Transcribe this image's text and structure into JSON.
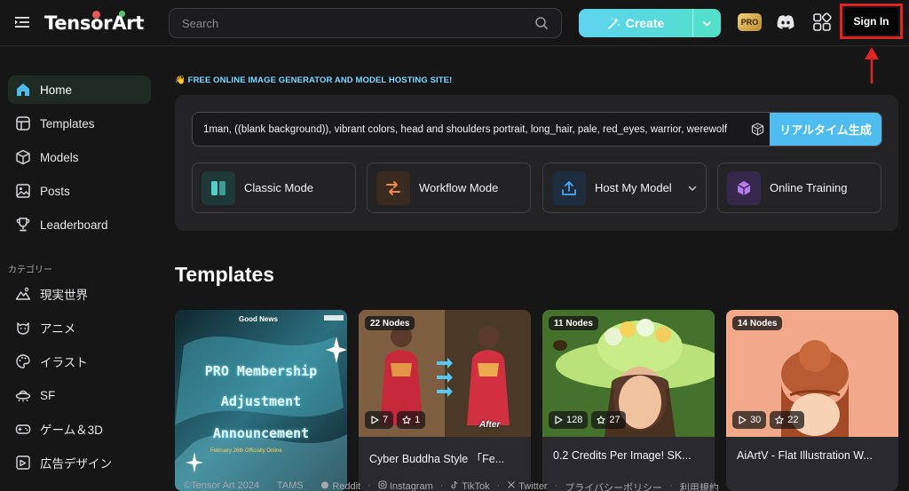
{
  "header": {
    "logo_text": "TensorArt",
    "search_placeholder": "Search",
    "create_label": "Create",
    "pro_label": "PRO",
    "signin_label": "Sign In"
  },
  "sidebar": {
    "items": [
      {
        "label": "Home",
        "icon": "home-icon"
      },
      {
        "label": "Templates",
        "icon": "templates-icon"
      },
      {
        "label": "Models",
        "icon": "cube-icon"
      },
      {
        "label": "Posts",
        "icon": "image-icon"
      },
      {
        "label": "Leaderboard",
        "icon": "trophy-icon"
      }
    ],
    "category_heading": "カテゴリー",
    "categories": [
      {
        "label": "現実世界",
        "icon": "landscape-icon"
      },
      {
        "label": "アニメ",
        "icon": "cat-face-icon"
      },
      {
        "label": "イラスト",
        "icon": "palette-icon"
      },
      {
        "label": "SF",
        "icon": "ufo-icon"
      },
      {
        "label": "ゲーム＆3D",
        "icon": "gamepad-icon"
      },
      {
        "label": "広告デザイン",
        "icon": "ad-icon"
      }
    ]
  },
  "main": {
    "banner": "👋 FREE ONLINE IMAGE GENERATOR AND MODEL HOSTING SITE!",
    "prompt_value": "1man, ((blank background)), vibrant colors, head and shoulders portrait, long_hair, pale, red_eyes, warrior, werewolf",
    "realtime_label": "リアルタイム生成",
    "modes": [
      {
        "label": "Classic Mode",
        "icon": "columns-icon",
        "color": "#4fd0c8"
      },
      {
        "label": "Workflow Mode",
        "icon": "workflow-icon",
        "color": "#f08a4b"
      },
      {
        "label": "Host My Model",
        "icon": "upload-icon",
        "color": "#4fa8f0"
      },
      {
        "label": "Online Training",
        "icon": "box-icon",
        "color": "#b57cf0"
      }
    ],
    "templates_title": "Templates",
    "templates": [
      {
        "title": "",
        "nodes": "",
        "runs": "",
        "stars": "",
        "poster_news": "Good News",
        "poster_lines": [
          "PRO Membership",
          "Adjustment",
          "Announcement"
        ],
        "poster_date": "February 26th Officially Online"
      },
      {
        "title": "Cyber Buddha Style 「Fe...",
        "nodes": "22 Nodes",
        "runs": "7",
        "stars": "1",
        "after_label": "After"
      },
      {
        "title": "0.2 Credits Per Image! SK...",
        "nodes": "11 Nodes",
        "runs": "128",
        "stars": "27"
      },
      {
        "title": "AiArtV - Flat Illustration W...",
        "nodes": "14 Nodes",
        "runs": "30",
        "stars": "22"
      }
    ]
  },
  "footer": {
    "links": [
      "©Tensor Art 2024",
      "TAMS",
      "Reddit",
      "Instagram",
      "TikTok",
      "Twitter",
      "プライバシーポリシー",
      "利用規約"
    ]
  },
  "colors": {
    "accent": "#4fbcf0",
    "create_gradient_start": "#5fd3f0",
    "create_gradient_end": "#52e0c8",
    "signin_highlight": "#e02424"
  }
}
